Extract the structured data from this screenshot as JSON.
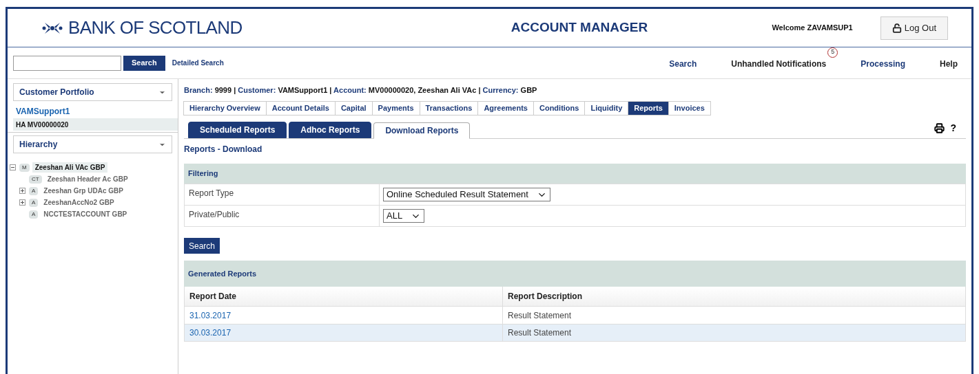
{
  "header": {
    "logo": "BANK OF SCOTLAND",
    "title": "ACCOUNT MANAGER",
    "welcome": "Welcome ZAVAMSUP1",
    "logout": "Log Out"
  },
  "searchbar": {
    "button": "Search",
    "detailed": "Detailed Search"
  },
  "topnav": [
    {
      "label": "Search",
      "kind": "link"
    },
    {
      "label": "Unhandled Notifications",
      "kind": "notify",
      "badge": "5"
    },
    {
      "label": "Processing",
      "kind": "link"
    },
    {
      "label": "Help",
      "kind": "plain"
    }
  ],
  "sidebar": {
    "portfolio": {
      "title": "Customer Portfolio",
      "customer": "VAMSupport1",
      "account": "HA MV00000020"
    },
    "hierarchy": {
      "title": "Hierarchy",
      "tree": [
        {
          "badge": "M",
          "name": "Zeeshan Ali VAc GBP",
          "expanded": true,
          "selected": true,
          "children": [
            {
              "badge": "CT",
              "name": "Zeeshan Header Ac GBP",
              "selected": false
            },
            {
              "badge": "A",
              "name": "Zeeshan Grp UDAc GBP",
              "expanded": false,
              "selected": false
            },
            {
              "badge": "A",
              "name": "ZeeshanAccNo2 GBP",
              "expanded": false,
              "selected": false
            },
            {
              "badge": "A",
              "name": "NCCTESTACCOUNT GBP",
              "selected": false
            }
          ]
        }
      ]
    }
  },
  "breadcrumb": {
    "separator": "|",
    "items": [
      {
        "label": "Branch:",
        "value": "9999"
      },
      {
        "label": "Customer:",
        "value": "VAMSupport1"
      },
      {
        "label": "Account:",
        "value": "MV00000020, Zeeshan Ali VAc"
      },
      {
        "label": "Currency:",
        "value": "GBP"
      }
    ]
  },
  "tabs": [
    {
      "label": "Hierarchy Overview",
      "selected": false
    },
    {
      "label": "Account Details",
      "selected": false
    },
    {
      "label": "Capital",
      "selected": false
    },
    {
      "label": "Payments",
      "selected": false
    },
    {
      "label": "Transactions",
      "selected": false
    },
    {
      "label": "Agreements",
      "selected": false
    },
    {
      "label": "Conditions",
      "selected": false
    },
    {
      "label": "Liquidity",
      "selected": false
    },
    {
      "label": "Reports",
      "selected": true
    },
    {
      "label": "Invoices",
      "selected": false
    }
  ],
  "subtabs": [
    {
      "label": "Scheduled Reports",
      "selected": false
    },
    {
      "label": "Adhoc Reports",
      "selected": false
    },
    {
      "label": "Download Reports",
      "selected": true
    }
  ],
  "help": "?",
  "page_title": "Reports - Download",
  "filtering": {
    "title": "Filtering",
    "rows": [
      {
        "label": "Report Type",
        "value": "Online Scheduled Result Statement"
      },
      {
        "label": "Private/Public",
        "value": "ALL"
      }
    ],
    "button": "Search"
  },
  "results": {
    "title": "Generated Reports",
    "columns": [
      "Report Date",
      "Report Description"
    ],
    "rows": [
      {
        "date": "31.03.2017",
        "description": "Result Statement"
      },
      {
        "date": "30.03.2017",
        "description": "Result Statement"
      }
    ]
  }
}
